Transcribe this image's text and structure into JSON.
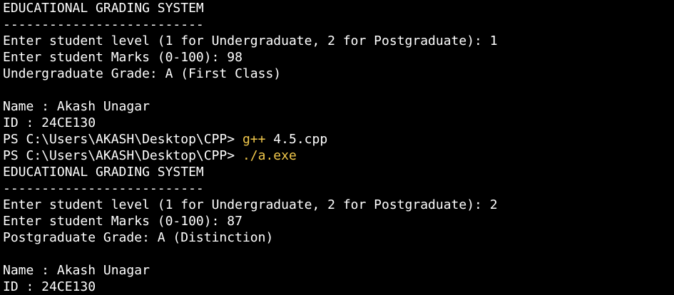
{
  "lines": [
    [
      {
        "text": "EDUCATIONAL GRADING SYSTEM"
      }
    ],
    [
      {
        "text": "--------------------------"
      }
    ],
    [
      {
        "text": "Enter student level (1 for Undergraduate, 2 for Postgraduate): 1"
      }
    ],
    [
      {
        "text": "Enter student Marks (0-100): 98"
      }
    ],
    [
      {
        "text": "Undergraduate Grade: A (First Class)"
      }
    ],
    [
      {
        "text": ""
      }
    ],
    [
      {
        "text": "Name : Akash Unagar"
      }
    ],
    [
      {
        "text": "ID : 24CE130"
      }
    ],
    [
      {
        "text": "PS C:\\Users\\AKASH\\Desktop\\CPP> "
      },
      {
        "text": "g++",
        "kind": "cmd"
      },
      {
        "text": " 4.5.cpp"
      }
    ],
    [
      {
        "text": "PS C:\\Users\\AKASH\\Desktop\\CPP> "
      },
      {
        "text": "./a.exe",
        "kind": "cmd"
      }
    ],
    [
      {
        "text": "EDUCATIONAL GRADING SYSTEM"
      }
    ],
    [
      {
        "text": "--------------------------"
      }
    ],
    [
      {
        "text": "Enter student level (1 for Undergraduate, 2 for Postgraduate): 2"
      }
    ],
    [
      {
        "text": "Enter student Marks (0-100): 87"
      }
    ],
    [
      {
        "text": "Postgraduate Grade: A (Distinction)"
      }
    ],
    [
      {
        "text": ""
      }
    ],
    [
      {
        "text": "Name : Akash Unagar"
      }
    ],
    [
      {
        "text": "ID : 24CE130"
      }
    ]
  ],
  "colors": {
    "background": "#000000",
    "foreground": "#ffffff",
    "command": "#f2c94c"
  }
}
